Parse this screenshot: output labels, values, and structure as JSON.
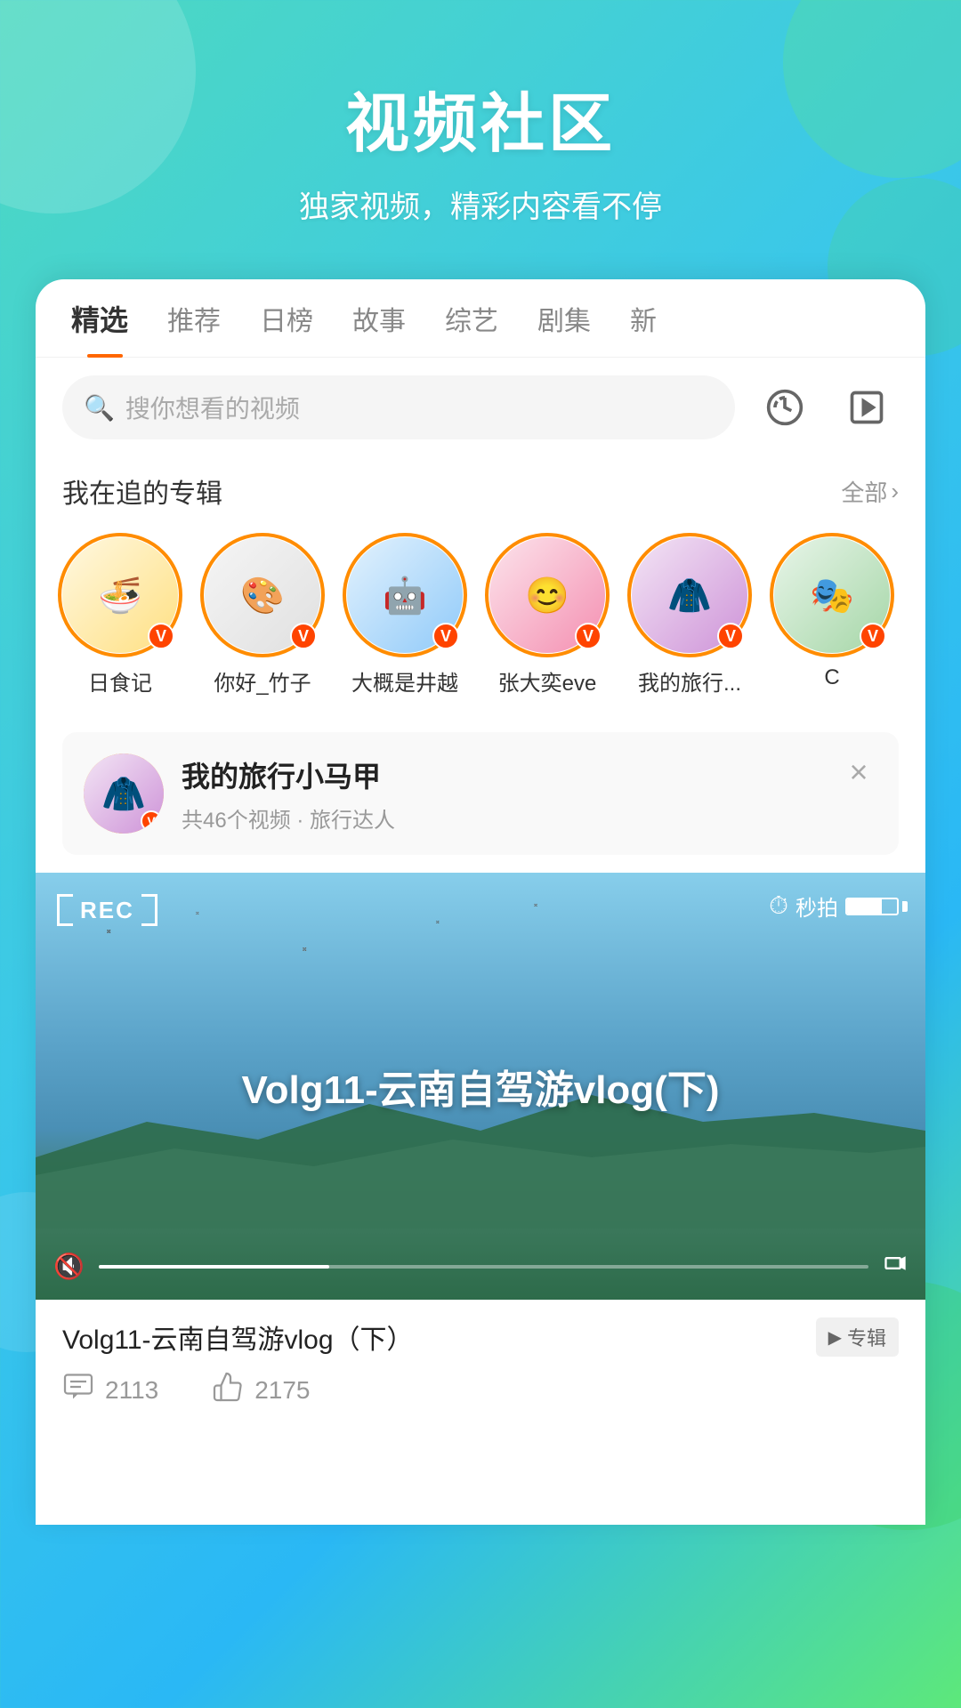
{
  "header": {
    "title": "视频社区",
    "subtitle": "独家视频，精彩内容看不停"
  },
  "tabs": [
    {
      "id": "jingxuan",
      "label": "精选",
      "active": true
    },
    {
      "id": "tuijian",
      "label": "推荐",
      "active": false
    },
    {
      "id": "ribang",
      "label": "日榜",
      "active": false
    },
    {
      "id": "gushi",
      "label": "故事",
      "active": false
    },
    {
      "id": "zongyi",
      "label": "综艺",
      "active": false
    },
    {
      "id": "juji",
      "label": "剧集",
      "active": false
    },
    {
      "id": "xin",
      "label": "新",
      "active": false
    }
  ],
  "search": {
    "placeholder": "搜你想看的视频"
  },
  "following_section": {
    "title": "我在追的专辑",
    "more_label": "全部"
  },
  "albums": [
    {
      "id": "rishuji",
      "name": "日食记",
      "emoji": "🍜"
    },
    {
      "id": "nihaozhuzi",
      "name": "你好_竹子",
      "emoji": "🎨"
    },
    {
      "id": "daigaishijing",
      "name": "大概是井越",
      "emoji": "🤖"
    },
    {
      "id": "zhangdayi",
      "name": "张大奕eve",
      "emoji": "😊"
    },
    {
      "id": "wodelvxing",
      "name": "我的旅行...",
      "emoji": "🧥"
    },
    {
      "id": "partial",
      "name": "C",
      "emoji": "🎭"
    }
  ],
  "featured": {
    "name": "我的旅行小马甲",
    "meta": "共46个视频 · 旅行达人",
    "avatar_emoji": "🧥"
  },
  "video": {
    "rec_label": "REC",
    "title_overlay": "Volg11-云南自驾游vlog(下)",
    "title_display": "Volg11-云南自驾游vlog（下）",
    "album_label": "专辑",
    "comment_count": "2113",
    "like_count": "2175",
    "miaopai_label": "秒拍"
  },
  "icons": {
    "search": "🔍",
    "history": "⏱",
    "playlist": "▷",
    "chevron_right": "›",
    "close": "×",
    "volume_off": "🔇",
    "fullscreen": "⛶",
    "comment": "💬",
    "like": "👍",
    "v_badge": "V",
    "play": "▶"
  },
  "colors": {
    "accent_orange": "#ff6600",
    "accent_ring": "#ff8c00",
    "badge_red": "#ff4400",
    "tab_active": "#333",
    "tab_inactive": "#888",
    "text_primary": "#222",
    "text_secondary": "#999",
    "bg_gradient_start": "#4dd9c0",
    "bg_gradient_end": "#5de87a"
  }
}
